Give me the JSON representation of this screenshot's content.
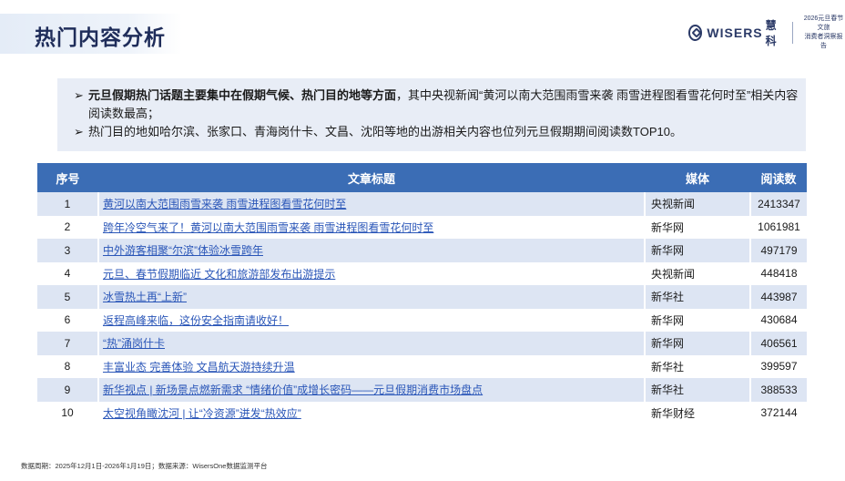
{
  "header": {
    "title": "热门内容分析",
    "logo_text": "WISERS",
    "logo_cn": "慧科",
    "report_line1": "2026元旦春节文旅",
    "report_line2": "消费者洞察报告"
  },
  "summary": {
    "bullet1_bold": "元旦假期热门话题主要集中在假期气候、热门目的地等方面",
    "bullet1_rest": "，其中央视新闻“黄河以南大范围雨雪来袭 雨雪进程图看雪花何时至”相关内容阅读数最高；",
    "bullet2": "热门目的地如哈尔滨、张家口、青海岗什卡、文昌、沈阳等地的出游相关内容也位列元旦假期期间阅读数TOP10。",
    "arrow": "➢"
  },
  "table": {
    "headers": [
      "序号",
      "文章标题",
      "媒体",
      "阅读数"
    ],
    "rows": [
      {
        "no": "1",
        "title": "黄河以南大范围雨雪来袭 雨雪进程图看雪花何时至",
        "media": "央视新闻",
        "reads": "2413347"
      },
      {
        "no": "2",
        "title": "跨年冷空气来了！黄河以南大范围雨雪来袭 雨雪进程图看雪花何时至",
        "media": "新华网",
        "reads": "1061981"
      },
      {
        "no": "3",
        "title": "中外游客相聚“尔滨”体验冰雪跨年",
        "media": "新华网",
        "reads": "497179"
      },
      {
        "no": "4",
        "title": "元旦、春节假期临近 文化和旅游部发布出游提示",
        "media": "央视新闻",
        "reads": "448418"
      },
      {
        "no": "5",
        "title": "冰雪热土再“上新”",
        "media": "新华社",
        "reads": "443987"
      },
      {
        "no": "6",
        "title": "返程高峰来临，这份安全指南请收好！",
        "media": "新华网",
        "reads": "430684"
      },
      {
        "no": "7",
        "title": "“热”涌岗什卡",
        "media": "新华网",
        "reads": "406561"
      },
      {
        "no": "8",
        "title": "丰富业态 完善体验 文昌航天游持续升温",
        "media": "新华社",
        "reads": "399597"
      },
      {
        "no": "9",
        "title": "新华视点 | 新场景点燃新需求 “情绪价值”成增长密码——元旦假期消费市场盘点",
        "media": "新华社",
        "reads": "388533"
      },
      {
        "no": "10",
        "title": "太空视角瞰沈河 | 让“冷资源”迸发“热效应”",
        "media": "新华财经",
        "reads": "372144"
      }
    ]
  },
  "footer": {
    "note": "数据周期：2025年12月1日-2026年1月19日；数据来源：WisersOne数据监测平台"
  }
}
